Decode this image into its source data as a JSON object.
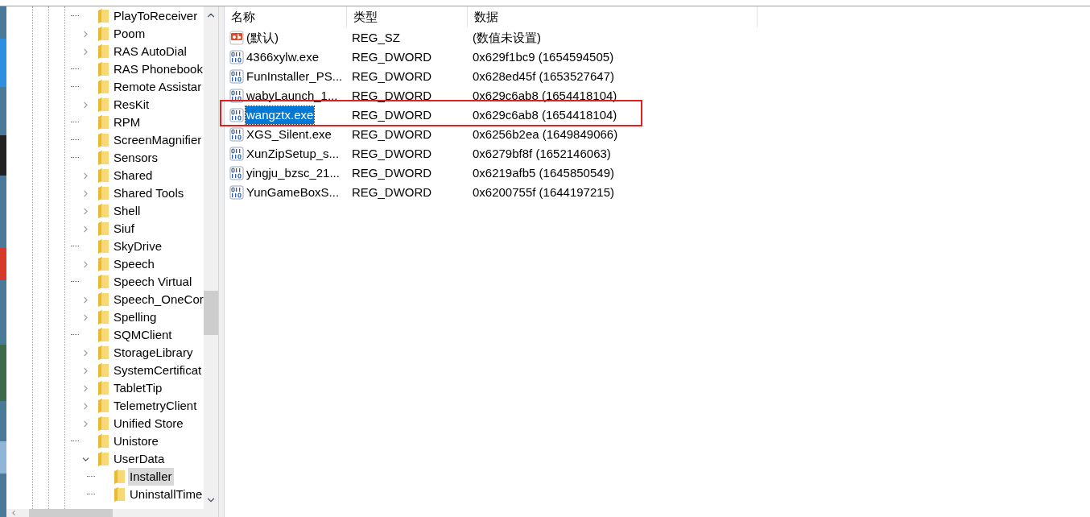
{
  "tree": {
    "items": [
      {
        "label": "PlayToReceiver",
        "expandable": false,
        "selected": false
      },
      {
        "label": "Poom",
        "expandable": true,
        "expanded": false,
        "selected": false
      },
      {
        "label": "RAS AutoDial",
        "expandable": true,
        "expanded": false,
        "selected": false
      },
      {
        "label": "RAS Phonebook",
        "expandable": false,
        "selected": false
      },
      {
        "label": "Remote Assistar",
        "expandable": false,
        "selected": false
      },
      {
        "label": "ResKit",
        "expandable": true,
        "expanded": false,
        "selected": false
      },
      {
        "label": "RPM",
        "expandable": false,
        "selected": false
      },
      {
        "label": "ScreenMagnifier",
        "expandable": false,
        "selected": false
      },
      {
        "label": "Sensors",
        "expandable": false,
        "selected": false
      },
      {
        "label": "Shared",
        "expandable": true,
        "expanded": false,
        "selected": false
      },
      {
        "label": "Shared Tools",
        "expandable": true,
        "expanded": false,
        "selected": false
      },
      {
        "label": "Shell",
        "expandable": true,
        "expanded": false,
        "selected": false
      },
      {
        "label": "Siuf",
        "expandable": true,
        "expanded": false,
        "selected": false
      },
      {
        "label": "SkyDrive",
        "expandable": false,
        "selected": false
      },
      {
        "label": "Speech",
        "expandable": true,
        "expanded": false,
        "selected": false
      },
      {
        "label": "Speech Virtual",
        "expandable": false,
        "selected": false
      },
      {
        "label": "Speech_OneCor",
        "expandable": true,
        "expanded": false,
        "selected": false
      },
      {
        "label": "Spelling",
        "expandable": true,
        "expanded": false,
        "selected": false
      },
      {
        "label": "SQMClient",
        "expandable": false,
        "selected": false
      },
      {
        "label": "StorageLibrary",
        "expandable": true,
        "expanded": false,
        "selected": false
      },
      {
        "label": "SystemCertificat",
        "expandable": true,
        "expanded": false,
        "selected": false
      },
      {
        "label": "TabletTip",
        "expandable": true,
        "expanded": false,
        "selected": false
      },
      {
        "label": "TelemetryClient",
        "expandable": true,
        "expanded": false,
        "selected": false
      },
      {
        "label": "Unified Store",
        "expandable": true,
        "expanded": false,
        "selected": false
      },
      {
        "label": "Unistore",
        "expandable": false,
        "selected": false
      },
      {
        "label": "UserData",
        "expandable": true,
        "expanded": true,
        "selected": false,
        "children": [
          {
            "label": "Installer",
            "expandable": false,
            "selected": true
          },
          {
            "label": "UninstallTime",
            "expandable": false,
            "selected": false
          }
        ]
      }
    ]
  },
  "values": {
    "columns": [
      "名称",
      "类型",
      "数据"
    ],
    "rows": [
      {
        "kind": "string",
        "name": "(默认)",
        "type": "REG_SZ",
        "data": "(数值未设置)",
        "selected": false
      },
      {
        "kind": "binary",
        "name": "4366xylw.exe",
        "type": "REG_DWORD",
        "data": "0x629f1bc9 (1654594505)",
        "selected": false
      },
      {
        "kind": "binary",
        "name": "FunInstaller_PS...",
        "type": "REG_DWORD",
        "data": "0x628ed45f (1653527647)",
        "selected": false
      },
      {
        "kind": "binary",
        "name": "wabyLaunch_1...",
        "type": "REG_DWORD",
        "data": "0x629c6ab8 (1654418104)",
        "selected": false
      },
      {
        "kind": "binary",
        "name": "wangztx.exe",
        "type": "REG_DWORD",
        "data": "0x629c6ab8 (1654418104)",
        "selected": true
      },
      {
        "kind": "binary",
        "name": "XGS_Silent.exe",
        "type": "REG_DWORD",
        "data": "0x6256b2ea (1649849066)",
        "selected": false
      },
      {
        "kind": "binary",
        "name": "XunZipSetup_s...",
        "type": "REG_DWORD",
        "data": "0x6279bf8f (1652146063)",
        "selected": false
      },
      {
        "kind": "binary",
        "name": "yingju_bzsc_21...",
        "type": "REG_DWORD",
        "data": "0x6219afb5 (1645850549)",
        "selected": false
      },
      {
        "kind": "binary",
        "name": "YunGameBoxS...",
        "type": "REG_DWORD",
        "data": "0x6200755f (1644197215)",
        "selected": false
      }
    ]
  }
}
